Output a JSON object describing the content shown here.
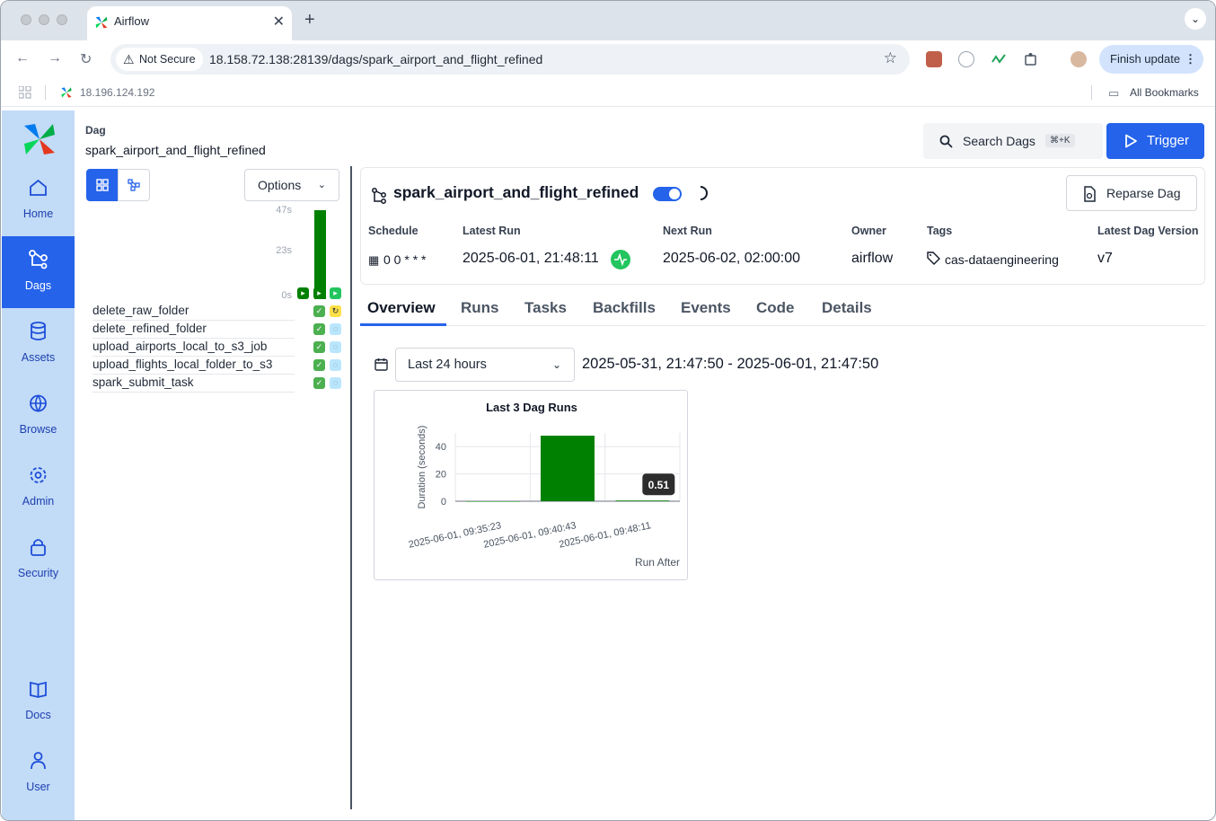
{
  "browser": {
    "tab_title": "Airflow",
    "not_secure": "Not Secure",
    "url": "18.158.72.138:28139/dags/spark_airport_and_flight_refined",
    "finish_update": "Finish update",
    "bookmark_host": "18.196.124.192",
    "all_bookmarks": "All Bookmarks"
  },
  "sidebar": {
    "items": [
      {
        "label": "Home",
        "icon": "home-icon"
      },
      {
        "label": "Dags",
        "icon": "dags-icon"
      },
      {
        "label": "Assets",
        "icon": "database-icon"
      },
      {
        "label": "Browse",
        "icon": "globe-icon"
      },
      {
        "label": "Admin",
        "icon": "gear-icon"
      },
      {
        "label": "Security",
        "icon": "lock-icon"
      },
      {
        "label": "Docs",
        "icon": "book-icon"
      },
      {
        "label": "User",
        "icon": "user-icon"
      }
    ],
    "active": "Dags"
  },
  "header": {
    "crumb": "Dag",
    "dag_id": "spark_airport_and_flight_refined",
    "search_label": "Search Dags",
    "search_shortcut": "⌘+K",
    "trigger_label": "Trigger"
  },
  "grid": {
    "options_label": "Options",
    "duration_ticks": [
      "47s",
      "23s",
      "0s"
    ],
    "tasks": [
      {
        "name": "delete_raw_folder",
        "states": [
          "success",
          "up_for_retry"
        ]
      },
      {
        "name": "delete_refined_folder",
        "states": [
          "success",
          "scheduled"
        ]
      },
      {
        "name": "upload_airports_local_to_s3_job",
        "states": [
          "success",
          "scheduled"
        ]
      },
      {
        "name": "upload_flights_local_folder_to_s3",
        "states": [
          "success",
          "scheduled"
        ]
      },
      {
        "name": "spark_submit_task",
        "states": [
          "success",
          "scheduled"
        ]
      }
    ]
  },
  "dag_card": {
    "title": "spark_airport_and_flight_refined",
    "reparse_label": "Reparse Dag",
    "schedule_label": "Schedule",
    "schedule_value": "0 0 * * *",
    "latest_run_label": "Latest Run",
    "latest_run_value": "2025-06-01, 21:48:11",
    "next_run_label": "Next Run",
    "next_run_value": "2025-06-02, 02:00:00",
    "owner_label": "Owner",
    "owner_value": "airflow",
    "tags_label": "Tags",
    "tags_value": "cas-dataengineering",
    "version_label": "Latest Dag Version",
    "version_value": "v7"
  },
  "tabs": [
    "Overview",
    "Runs",
    "Tasks",
    "Backfills",
    "Events",
    "Code",
    "Details"
  ],
  "active_tab": "Overview",
  "overview": {
    "range_label": "Last 24 hours",
    "range_text": "2025-05-31, 21:47:50 - 2025-06-01, 21:47:50"
  },
  "chart_data": {
    "type": "bar",
    "title": "Last 3 Dag Runs",
    "xlabel": "Run After",
    "ylabel": "Duration (seconds)",
    "categories": [
      "2025-06-01, 09:35:23",
      "2025-06-01, 09:40:43",
      "2025-06-01, 09:48:11"
    ],
    "values": [
      0,
      48,
      0.51
    ],
    "y_ticks": [
      0,
      20,
      40
    ],
    "ylim": [
      0,
      50
    ],
    "tooltip": "0.51",
    "bar_color": "#008000"
  },
  "colors": {
    "primary": "#2563eb",
    "sidebar_bg": "#c2dbf7",
    "success": "#4caf50",
    "bar": "#008000"
  }
}
